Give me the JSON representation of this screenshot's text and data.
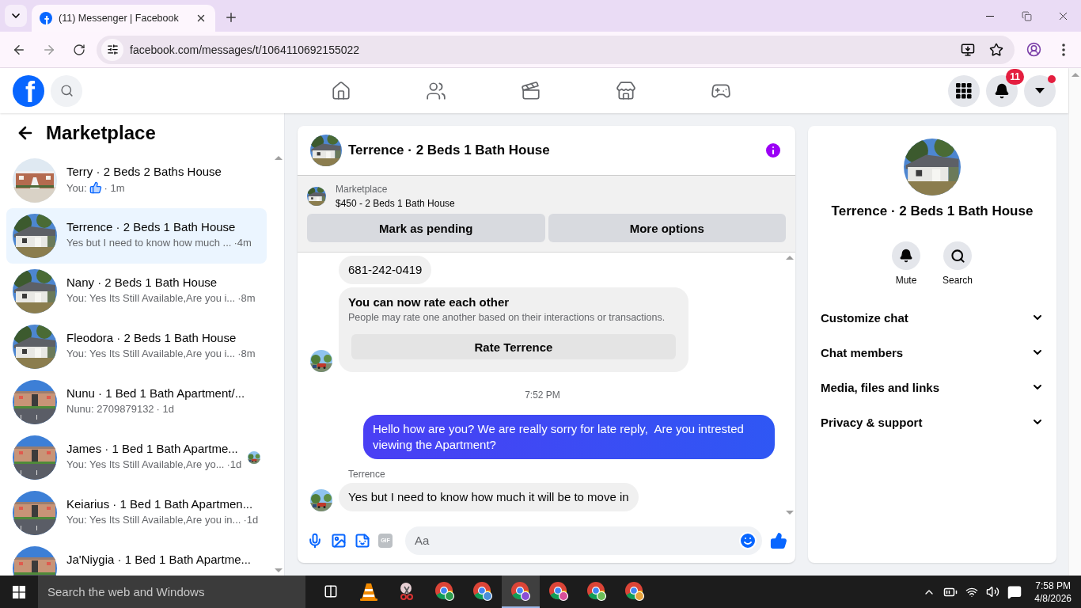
{
  "browser": {
    "tab_title": "(11) Messenger | Facebook",
    "url": "facebook.com/messages/t/1064110692155022"
  },
  "header": {
    "logo": "f",
    "nav": [
      {
        "kind": "home"
      },
      {
        "kind": "friends"
      },
      {
        "kind": "video"
      },
      {
        "kind": "marketplace"
      },
      {
        "kind": "gaming"
      }
    ],
    "notifications": "11",
    "account_dot": true
  },
  "sidebar": {
    "title": "Marketplace",
    "conversations": [
      {
        "name": "Terry · 2 Beds 2 Baths House",
        "kind": "like",
        "preview": "You:",
        "time": "· 1m",
        "selected": false,
        "seen": false
      },
      {
        "name": "Terrence · 2 Beds 1 Bath House",
        "kind": "text",
        "preview": "Yes but I need to know how much ...",
        "time": "·4m",
        "selected": true,
        "seen": false
      },
      {
        "name": "Nany · 2 Beds 1 Bath House",
        "kind": "text",
        "preview": "You: Yes Its Still Available,Are you i...",
        "time": "·8m",
        "selected": false,
        "seen": false
      },
      {
        "name": "Fleodora · 2 Beds 1 Bath House",
        "kind": "text",
        "preview": "You: Yes Its Still Available,Are you i...",
        "time": "·8m",
        "selected": false,
        "seen": false
      },
      {
        "name": "Nunu · 1 Bed 1 Bath Apartment/...",
        "kind": "text",
        "preview": "Nunu: 2709879132",
        "time": "· 1d",
        "selected": false,
        "seen": false
      },
      {
        "name": "James · 1 Bed 1 Bath Apartme...",
        "kind": "text",
        "preview": "You: Yes Its Still Available,Are yo...",
        "time": "·1d",
        "selected": false,
        "seen": true
      },
      {
        "name": "Keiarius · 1 Bed 1 Bath Apartmen...",
        "kind": "text",
        "preview": "You: Yes Its Still Available,Are you in...",
        "time": "·1d",
        "selected": false,
        "seen": false
      },
      {
        "name": "Ja'Niygia · 1 Bed 1 Bath Apartme...",
        "selected": false,
        "seen": false
      }
    ]
  },
  "chat": {
    "title": "Terrence · 2 Beds 1 Bath House",
    "listing_label": "Marketplace",
    "listing": "$450 - 2 Beds 1 Bath House",
    "actions": [
      "Mark as pending",
      "More options"
    ],
    "messages": [
      {
        "kind": "incoming",
        "text": "681-242-0419",
        "avatar": false
      },
      {
        "kind": "rating",
        "title": "You can now rate each other",
        "text": "People may rate one another based on their interactions or transactions.",
        "button": "Rate Terrence",
        "avatar": true
      },
      {
        "kind": "timestamp",
        "text": "7:52 PM"
      },
      {
        "kind": "outgoing",
        "text": "Hello how are you? We are really sorry for late reply,  Are you intrested viewing the Apartment?"
      },
      {
        "kind": "sender",
        "text": "Terrence"
      },
      {
        "kind": "incoming",
        "text": "Yes but I need to know how much it will be to move in",
        "avatar": true
      }
    ],
    "composer": {
      "gif": "GIF",
      "placeholder": "Aa"
    }
  },
  "info": {
    "name": "Terrence · 2 Beds 1 Bath House",
    "actions": [
      {
        "kind": "mute",
        "label": "Mute"
      },
      {
        "kind": "search",
        "label": "Search"
      }
    ],
    "sections": [
      {
        "label": "Customize chat",
        "expanded": false
      },
      {
        "label": "Chat members",
        "expanded": false
      },
      {
        "label": "Media, files and links",
        "expanded": false
      },
      {
        "label": "Privacy & support",
        "expanded": false
      }
    ]
  },
  "taskbar": {
    "search_placeholder": "Search the web and Windows",
    "apps": [
      {
        "kind": "task-view",
        "selected": false
      },
      {
        "kind": "vlc",
        "selected": false
      },
      {
        "kind": "snip",
        "selected": false
      },
      {
        "kind": "chrome",
        "color": "#2e9e4f",
        "selected": false
      },
      {
        "kind": "chrome",
        "color": "#4a8fd9",
        "selected": false
      },
      {
        "kind": "chrome",
        "color": "#8a4fd6",
        "selected": true
      },
      {
        "kind": "chrome",
        "color": "#d94f9a",
        "selected": false
      },
      {
        "kind": "chrome",
        "color": "#6bbf59",
        "selected": false
      },
      {
        "kind": "chrome",
        "color": "#e8a33d",
        "selected": false
      }
    ],
    "time": "7:58 PM",
    "date": "4/8/2026"
  }
}
